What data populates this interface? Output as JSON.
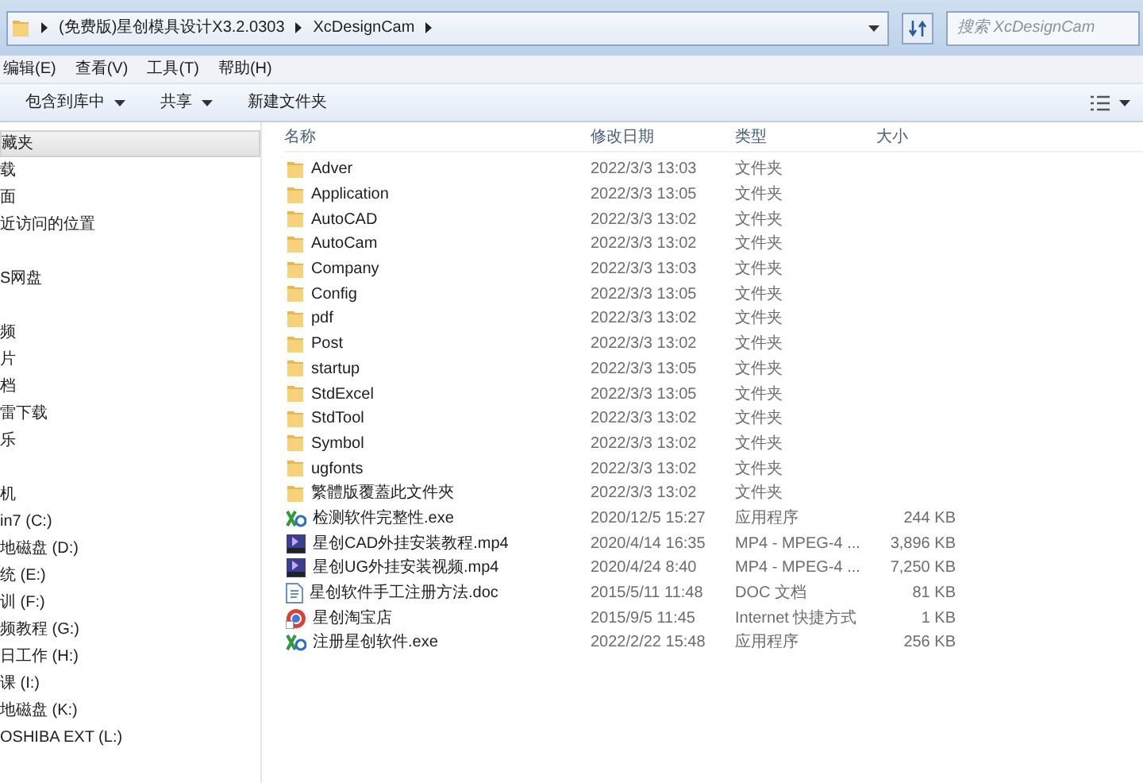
{
  "address_bar": {
    "path": [
      "(免费版)星创模具设计X3.2.0303",
      "XcDesignCam"
    ]
  },
  "search": {
    "placeholder": "搜索 XcDesignCam"
  },
  "menu": [
    "编辑(E)",
    "查看(V)",
    "工具(T)",
    "帮助(H)"
  ],
  "toolbar": [
    {
      "label": "包含到库中",
      "dropdown": true
    },
    {
      "label": "共享",
      "dropdown": true
    },
    {
      "label": "新建文件夹",
      "dropdown": false
    }
  ],
  "sidebar": {
    "groups": [
      {
        "items": [
          {
            "label": "藏夹",
            "selected": true
          },
          {
            "label": "载",
            "selected": false
          },
          {
            "label": "面",
            "selected": false
          },
          {
            "label": "近访问的位置",
            "selected": false
          }
        ]
      },
      {
        "items": [
          {
            "label": "S网盘",
            "selected": false
          }
        ]
      },
      {
        "items": [
          {
            "label": "频",
            "selected": false
          },
          {
            "label": "片",
            "selected": false
          },
          {
            "label": "档",
            "selected": false
          },
          {
            "label": "雷下载",
            "selected": false
          },
          {
            "label": "乐",
            "selected": false
          }
        ]
      },
      {
        "items": [
          {
            "label": "机",
            "selected": false
          },
          {
            "label": "in7 (C:)",
            "selected": false
          },
          {
            "label": "地磁盘 (D:)",
            "selected": false
          },
          {
            "label": "统 (E:)",
            "selected": false
          },
          {
            "label": "训 (F:)",
            "selected": false
          },
          {
            "label": "频教程 (G:)",
            "selected": false
          },
          {
            "label": "日工作 (H:)",
            "selected": false
          },
          {
            "label": "课 (I:)",
            "selected": false
          },
          {
            "label": "地磁盘 (K:)",
            "selected": false
          },
          {
            "label": "OSHIBA EXT (L:)",
            "selected": false
          }
        ]
      }
    ]
  },
  "table": {
    "columns": [
      "名称",
      "修改日期",
      "类型",
      "大小"
    ],
    "rows": [
      {
        "kind": "folder",
        "name": "Adver",
        "date": "2022/3/3 13:03",
        "type": "文件夹"
      },
      {
        "kind": "folder",
        "name": "Application",
        "date": "2022/3/3 13:05",
        "type": "文件夹"
      },
      {
        "kind": "folder",
        "name": "AutoCAD",
        "date": "2022/3/3 13:02",
        "type": "文件夹"
      },
      {
        "kind": "folder",
        "name": "AutoCam",
        "date": "2022/3/3 13:02",
        "type": "文件夹"
      },
      {
        "kind": "folder",
        "name": "Company",
        "date": "2022/3/3 13:03",
        "type": "文件夹"
      },
      {
        "kind": "folder",
        "name": "Config",
        "date": "2022/3/3 13:05",
        "type": "文件夹"
      },
      {
        "kind": "folder",
        "name": "pdf",
        "date": "2022/3/3 13:02",
        "type": "文件夹"
      },
      {
        "kind": "folder",
        "name": "Post",
        "date": "2022/3/3 13:02",
        "type": "文件夹"
      },
      {
        "kind": "folder",
        "name": "startup",
        "date": "2022/3/3 13:05",
        "type": "文件夹"
      },
      {
        "kind": "folder",
        "name": "StdExcel",
        "date": "2022/3/3 13:05",
        "type": "文件夹"
      },
      {
        "kind": "folder",
        "name": "StdTool",
        "date": "2022/3/3 13:02",
        "type": "文件夹"
      },
      {
        "kind": "folder",
        "name": "Symbol",
        "date": "2022/3/3 13:02",
        "type": "文件夹"
      },
      {
        "kind": "folder",
        "name": "ugfonts",
        "date": "2022/3/3 13:02",
        "type": "文件夹"
      },
      {
        "kind": "folder",
        "name": "繁體版覆蓋此文件夾",
        "date": "2022/3/3 13:02",
        "type": "文件夹"
      },
      {
        "kind": "exe",
        "name": "检测软件完整性.exe",
        "date": "2020/12/5 15:27",
        "type": "应用程序",
        "size": "244 KB"
      },
      {
        "kind": "video",
        "name": "星创CAD外挂安装教程.mp4",
        "date": "2020/4/14 16:35",
        "type": "MP4 - MPEG-4 ...",
        "size": "3,896 KB"
      },
      {
        "kind": "video",
        "name": "星创UG外挂安装视频.mp4",
        "date": "2020/4/24 8:40",
        "type": "MP4 - MPEG-4 ...",
        "size": "7,250 KB"
      },
      {
        "kind": "doc",
        "name": "星创软件手工注册方法.doc",
        "date": "2015/5/11 11:48",
        "type": "DOC 文档",
        "size": "81 KB"
      },
      {
        "kind": "link",
        "name": "星创淘宝店",
        "date": "2015/9/5 11:45",
        "type": "Internet 快捷方式",
        "size": "1 KB"
      },
      {
        "kind": "exe",
        "name": "注册星创软件.exe",
        "date": "2022/2/22 15:48",
        "type": "应用程序",
        "size": "256 KB"
      }
    ]
  }
}
